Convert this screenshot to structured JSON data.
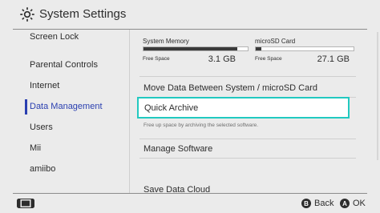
{
  "header": {
    "title": "System Settings",
    "icon": "gear-icon"
  },
  "sidebar": {
    "items": [
      {
        "label": "Screen Lock"
      },
      {
        "label": "Parental Controls"
      },
      {
        "label": "Internet"
      },
      {
        "label": "Data Management",
        "active": true
      },
      {
        "label": "Users"
      },
      {
        "label": "Mii"
      },
      {
        "label": "amiibo"
      }
    ]
  },
  "storage": {
    "system": {
      "title": "System Memory",
      "free_label": "Free Space",
      "free_value": "3.1 GB",
      "used_fraction": 0.9
    },
    "sd": {
      "title": "microSD Card",
      "free_label": "Free Space",
      "free_value": "27.1 GB",
      "used_fraction": 0.06
    }
  },
  "menu": {
    "move_data": "Move Data Between System / microSD Card",
    "quick_archive": "Quick Archive",
    "quick_archive_desc": "Free up space by archiving the selected software.",
    "manage_software": "Manage Software",
    "save_data_cloud": "Save Data Cloud"
  },
  "footer": {
    "back": {
      "key": "B",
      "label": "Back"
    },
    "ok": {
      "key": "A",
      "label": "OK"
    }
  },
  "colors": {
    "accent": "#2a3fb0",
    "selection": "#22c9c0",
    "background": "#ebebeb"
  }
}
